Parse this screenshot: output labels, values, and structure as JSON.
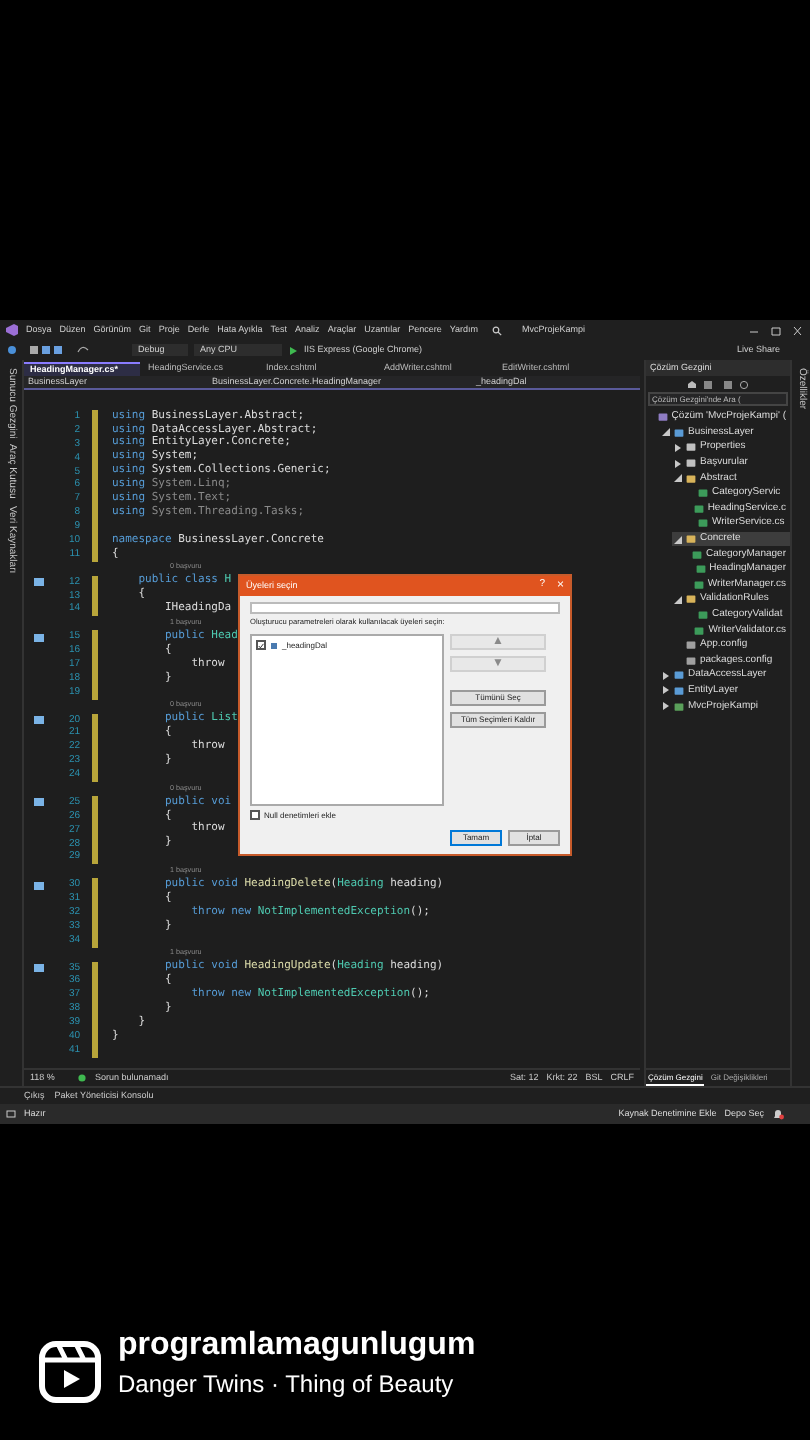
{
  "vs": {
    "menu": [
      "Dosya",
      "Düzen",
      "Görünüm",
      "Git",
      "Proje",
      "Derle",
      "Hata Ayıkla",
      "Test",
      "Analiz",
      "Araçlar",
      "Uzantılar",
      "Pencere",
      "Yardım"
    ],
    "title": "MvcProjeKampi",
    "toolbar": {
      "config": "Debug",
      "platform": "Any CPU",
      "run": "IIS Express (Google Chrome)",
      "live_share": "Live Share"
    },
    "left_strip": [
      "Sunucu Gezgini",
      "Araç Kutusu",
      "Veri Kaynakları"
    ],
    "right_strip": [
      "Özellikler"
    ],
    "tabs": [
      {
        "label": "HeadingManager.cs*",
        "selected": true
      },
      {
        "label": "HeadingService.cs",
        "selected": false
      },
      {
        "label": "Index.cshtml",
        "selected": false
      },
      {
        "label": "AddWriter.cshtml",
        "selected": false
      },
      {
        "label": "EditWriter.cshtml",
        "selected": false
      }
    ],
    "nav": [
      "BusinessLayer",
      "BusinessLayer.Concrete.HeadingManager",
      "_headingDal"
    ],
    "code": [
      {
        "kind": "code",
        "number": "1",
        "tokens": [
          {
            "kind": "kw",
            "text": "using"
          },
          {
            "kind": "plain",
            "text": " BusinessLayer.Abstract;"
          }
        ]
      },
      {
        "kind": "code",
        "number": "2",
        "tokens": [
          {
            "kind": "kw",
            "text": "using"
          },
          {
            "kind": "plain",
            "text": " DataAccessLayer.Abstract;"
          }
        ]
      },
      {
        "kind": "code",
        "number": "3",
        "tokens": [
          {
            "kind": "kw",
            "text": "using"
          },
          {
            "kind": "plain",
            "text": " EntityLayer.Concrete;"
          }
        ]
      },
      {
        "kind": "code",
        "number": "4",
        "tokens": [
          {
            "kind": "kw",
            "text": "using"
          },
          {
            "kind": "plain",
            "text": " System;"
          }
        ]
      },
      {
        "kind": "code",
        "number": "5",
        "tokens": [
          {
            "kind": "kw",
            "text": "using"
          },
          {
            "kind": "plain",
            "text": " System.Collections.Generic;"
          }
        ]
      },
      {
        "kind": "code",
        "number": "6",
        "tokens": [
          {
            "kind": "kw",
            "text": "using"
          },
          {
            "kind": "dim",
            "text": " System.Linq;"
          }
        ]
      },
      {
        "kind": "code",
        "number": "7",
        "tokens": [
          {
            "kind": "kw",
            "text": "using"
          },
          {
            "kind": "dim",
            "text": " System.Text;"
          }
        ]
      },
      {
        "kind": "code",
        "number": "8",
        "tokens": [
          {
            "kind": "kw",
            "text": "using"
          },
          {
            "kind": "dim",
            "text": " System.Threading.Tasks;"
          }
        ]
      },
      {
        "kind": "code",
        "number": "9"
      },
      {
        "kind": "code",
        "number": "10",
        "tokens": [
          {
            "kind": "kw",
            "text": "namespace"
          },
          {
            "kind": "plain",
            "text": " BusinessLayer.Concrete"
          }
        ]
      },
      {
        "kind": "code",
        "number": "11",
        "tokens": [
          {
            "kind": "plain",
            "text": "{"
          }
        ]
      },
      {
        "kind": "lens",
        "text": "0 başvuru"
      },
      {
        "kind": "code",
        "number": "12",
        "marker": true,
        "tokens": [
          {
            "kind": "kw",
            "text": "    public class"
          },
          {
            "kind": "type",
            "text": " H"
          }
        ]
      },
      {
        "kind": "code",
        "number": "13",
        "tokens": [
          {
            "kind": "plain",
            "text": "    {"
          }
        ]
      },
      {
        "kind": "code",
        "number": "14",
        "tokens": [
          {
            "kind": "plain",
            "text": "        IHeadingDa"
          }
        ]
      },
      {
        "kind": "lens",
        "text": "1 başvuru"
      },
      {
        "kind": "code",
        "number": "15",
        "marker": true,
        "tokens": [
          {
            "kind": "kw",
            "text": "        public"
          },
          {
            "kind": "type",
            "text": " Head"
          }
        ]
      },
      {
        "kind": "code",
        "number": "16",
        "tokens": [
          {
            "kind": "plain",
            "text": "        {"
          }
        ]
      },
      {
        "kind": "code",
        "number": "17",
        "tokens": [
          {
            "kind": "plain",
            "text": "            throw"
          }
        ]
      },
      {
        "kind": "code",
        "number": "18",
        "tokens": [
          {
            "kind": "plain",
            "text": "        }"
          }
        ]
      },
      {
        "kind": "code",
        "number": "19"
      },
      {
        "kind": "lens",
        "text": "0 başvuru"
      },
      {
        "kind": "code",
        "number": "20",
        "marker": true,
        "tokens": [
          {
            "kind": "kw",
            "text": "        public"
          },
          {
            "kind": "type",
            "text": " List"
          }
        ]
      },
      {
        "kind": "code",
        "number": "21",
        "tokens": [
          {
            "kind": "plain",
            "text": "        {"
          }
        ]
      },
      {
        "kind": "code",
        "number": "22",
        "tokens": [
          {
            "kind": "plain",
            "text": "            throw"
          }
        ]
      },
      {
        "kind": "code",
        "number": "23",
        "tokens": [
          {
            "kind": "plain",
            "text": "        }"
          }
        ]
      },
      {
        "kind": "code",
        "number": "24"
      },
      {
        "kind": "lens",
        "text": "0 başvuru"
      },
      {
        "kind": "code",
        "number": "25",
        "marker": true,
        "tokens": [
          {
            "kind": "kw",
            "text": "        public voi"
          }
        ]
      },
      {
        "kind": "code",
        "number": "26",
        "tokens": [
          {
            "kind": "plain",
            "text": "        {"
          }
        ]
      },
      {
        "kind": "code",
        "number": "27",
        "tokens": [
          {
            "kind": "plain",
            "text": "            throw"
          }
        ]
      },
      {
        "kind": "code",
        "number": "28",
        "tokens": [
          {
            "kind": "plain",
            "text": "        }"
          }
        ]
      },
      {
        "kind": "code",
        "number": "29"
      },
      {
        "kind": "lens",
        "text": "1 başvuru"
      },
      {
        "kind": "code",
        "number": "30",
        "marker": true,
        "tokens": [
          {
            "kind": "kw",
            "text": "        public void"
          },
          {
            "kind": "method",
            "text": " HeadingDelete"
          },
          {
            "kind": "plain",
            "text": "("
          },
          {
            "kind": "type",
            "text": "Heading"
          },
          {
            "kind": "plain",
            "text": " heading)"
          }
        ]
      },
      {
        "kind": "code",
        "number": "31",
        "tokens": [
          {
            "kind": "plain",
            "text": "        {"
          }
        ]
      },
      {
        "kind": "code",
        "number": "32",
        "tokens": [
          {
            "kind": "kw",
            "text": "            throw new"
          },
          {
            "kind": "type",
            "text": " NotImplementedException"
          },
          {
            "kind": "plain",
            "text": "();"
          }
        ]
      },
      {
        "kind": "code",
        "number": "33",
        "tokens": [
          {
            "kind": "plain",
            "text": "        }"
          }
        ]
      },
      {
        "kind": "code",
        "number": "34"
      },
      {
        "kind": "lens",
        "text": "1 başvuru"
      },
      {
        "kind": "code",
        "number": "35",
        "marker": true,
        "tokens": [
          {
            "kind": "kw",
            "text": "        public void"
          },
          {
            "kind": "method",
            "text": " HeadingUpdate"
          },
          {
            "kind": "plain",
            "text": "("
          },
          {
            "kind": "type",
            "text": "Heading"
          },
          {
            "kind": "plain",
            "text": " heading)"
          }
        ]
      },
      {
        "kind": "code",
        "number": "36",
        "tokens": [
          {
            "kind": "plain",
            "text": "        {"
          }
        ]
      },
      {
        "kind": "code",
        "number": "37",
        "tokens": [
          {
            "kind": "kw",
            "text": "            throw new"
          },
          {
            "kind": "type",
            "text": " NotImplementedException"
          },
          {
            "kind": "plain",
            "text": "();"
          }
        ]
      },
      {
        "kind": "code",
        "number": "38",
        "tokens": [
          {
            "kind": "plain",
            "text": "        }"
          }
        ]
      },
      {
        "kind": "code",
        "number": "39",
        "tokens": [
          {
            "kind": "plain",
            "text": "    }"
          }
        ]
      },
      {
        "kind": "code",
        "number": "40",
        "tokens": [
          {
            "kind": "plain",
            "text": "}"
          }
        ]
      },
      {
        "kind": "code",
        "number": "41"
      }
    ],
    "dialog": {
      "title": "Üyeleri seçin",
      "help": "?",
      "close": "×",
      "prompt": "Oluşturucu parametreleri olarak kullanılacak üyeleri seçin:",
      "members": [
        {
          "label": "_headingDal",
          "checked": true
        }
      ],
      "side_buttons": [
        {
          "label": "▲",
          "disabled": true
        },
        {
          "label": "▼",
          "disabled": true
        },
        {
          "label": "Tümünü Seç",
          "disabled": false
        },
        {
          "label": "Tüm Seçimleri Kaldır",
          "disabled": false
        }
      ],
      "null_checks": {
        "label": "Null denetimleri ekle",
        "checked": false
      },
      "buttons": [
        "Tamam",
        "İptal"
      ]
    },
    "editor_status": {
      "zoom": "118 %",
      "issues": "Sorun bulunamadı",
      "line": "Sat: 12",
      "col": "Krkt: 22",
      "tabs": "BSL",
      "eol": "CRLF"
    },
    "explorer": {
      "title": "Çözüm Gezgini",
      "search": {
        "placeholder": "Çözüm Gezgini'nde Ara ("
      },
      "tree": [
        {
          "label": "Çözüm 'MvcProjeKampi' (",
          "kind": "solution",
          "selected": false,
          "children": [
            {
              "label": "BusinessLayer",
              "kind": "project",
              "expanded": true,
              "selected": false,
              "children": [
                {
                  "label": "Properties",
                  "kind": "properties",
                  "expanded": false,
                  "selected": false
                },
                {
                  "label": "Başvurular",
                  "kind": "refs",
                  "expanded": false,
                  "selected": false
                },
                {
                  "label": "Abstract",
                  "kind": "folder",
                  "expanded": true,
                  "selected": false,
                  "children": [
                    {
                      "label": "CategoryServic",
                      "kind": "cs",
                      "selected": false
                    },
                    {
                      "label": "HeadingService.c",
                      "kind": "cs",
                      "selected": false
                    },
                    {
                      "label": "WriterService.cs",
                      "kind": "cs",
                      "selected": false
                    }
                  ]
                },
                {
                  "label": "Concrete",
                  "kind": "folder",
                  "expanded": true,
                  "selected": true,
                  "children": [
                    {
                      "label": "CategoryManager",
                      "kind": "cs",
                      "selected": false
                    },
                    {
                      "label": "HeadingManager",
                      "kind": "cs",
                      "selected": false
                    },
                    {
                      "label": "WriterManager.cs",
                      "kind": "cs",
                      "selected": false
                    }
                  ]
                },
                {
                  "label": "ValidationRules",
                  "kind": "folder",
                  "expanded": true,
                  "selected": false,
                  "children": [
                    {
                      "label": "CategoryValidat",
                      "kind": "cs",
                      "selected": false
                    },
                    {
                      "label": "WriterValidator.cs",
                      "kind": "cs",
                      "selected": false
                    }
                  ]
                },
                {
                  "label": "App.config",
                  "kind": "config",
                  "selected": false
                },
                {
                  "label": "packages.config",
                  "kind": "config",
                  "selected": false
                }
              ]
            },
            {
              "label": "DataAccessLayer",
              "kind": "project",
              "expanded": false,
              "selected": false
            },
            {
              "label": "EntityLayer",
              "kind": "project",
              "expanded": false,
              "selected": false
            },
            {
              "label": "MvcProjeKampi",
              "kind": "web",
              "expanded": false,
              "selected": false
            }
          ]
        }
      ],
      "bottom_tabs": [
        {
          "label": "Çözüm Gezgini",
          "selected": true
        },
        {
          "label": "Git Değişiklikleri",
          "selected": false
        }
      ]
    },
    "output_tabs": [
      "Çıkış",
      "Paket Yöneticisi Konsolu"
    ],
    "status": {
      "ready": "Hazır",
      "source_control": "Kaynak Denetimine Ekle",
      "repo": "Depo Seç"
    }
  },
  "reel": {
    "account": "programlamagunlugum",
    "audio": "Danger Twins · Thing of Beauty"
  }
}
